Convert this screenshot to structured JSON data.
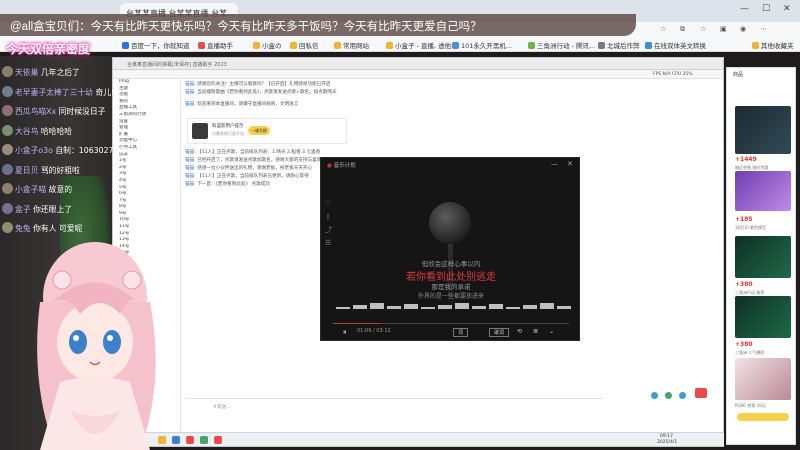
{
  "browser": {
    "tabs": [
      "台某某直播 台某某直播 台某...",
      "你好"
    ],
    "bookmarks": [
      "百度一下，你就知道",
      "直播助手",
      "小盒の",
      "回私信",
      "常用网站",
      "小盒子 - 直播, 透他...",
      "101永久开黑机...",
      "三角洲行动 - 腾讯...",
      "北城后作弊",
      "在线双体英文转换",
      "其他收藏夹"
    ],
    "window_controls": [
      "—",
      "☐",
      "✕"
    ]
  },
  "overlay": {
    "title": "@all盒宝贝们：今天有比昨天更快乐吗？今天有比昨天多干饭吗？今天有比昨天更爱自己吗？",
    "banner": "今天双倍亲密度"
  },
  "danmaku": [
    {
      "name": "天依巢",
      "text": "几年之后了",
      "color": "#8a7d6b"
    },
    {
      "name": "老早妻子太棒了三十幼",
      "text": "奇儿!",
      "color": "#6f7d8f"
    },
    {
      "name": "西瓜鸟喵Xx",
      "text": "同时候没日子",
      "color": "#8f6f6f"
    },
    {
      "name": "大谷鸟",
      "text": "哈哈哈哈",
      "color": "#7a8f6f"
    },
    {
      "name": "小盒子o3o",
      "text": "自制：1063027302",
      "color": "#9c8d7a"
    },
    {
      "name": "夏日贝",
      "text": "骂的好粗啦",
      "color": "#6f6f8f"
    },
    {
      "name": "小盒子喵",
      "text": "故意的",
      "color": "#8f7f6f"
    },
    {
      "name": "盒子",
      "text": "你还眼上了",
      "color": "#7a6f8f"
    },
    {
      "name": "兔兔",
      "text": "你有人 可爱呢",
      "color": "#8f8f6f"
    }
  ],
  "remote": {
    "titlebar": "台某某直播间的弹幕[未保存]  直播助手  2023",
    "toolbar_right": "FPS  N/A    CPU  35%",
    "sidebar_items": [
      "Prog",
      "主题",
      "功能",
      "我的",
      "直播工具",
      "三角洲的行动",
      "设置",
      "管理",
      "扩展",
      "功能中心",
      "在线工具",
      "投屏",
      "1号",
      "2号",
      "3号",
      "4号",
      "5号",
      "6号",
      "7号",
      "8号",
      "9号",
      "10号",
      "11号",
      "12号",
      "13号",
      "14号",
      "15号",
      "16号",
      "17号",
      "18号",
      "19号",
      "20号",
      "21号",
      "22号",
      "23号",
      "24号",
      "25号",
      "26号",
      "27号",
      "28号",
      "29号",
      "30号",
      "31号",
      "32号",
      "33号",
      "34号",
      "35号",
      "36号",
      "37号",
      "38号",
      "39号",
      "40号",
      "41号",
      "42号",
      "43号"
    ],
    "messages": [
      {
        "name": "猫猫:",
        "text": "感谢您的关注！主播可以唱歌吗？【已开启】礼物感谢功能已开启"
      },
      {
        "name": "猫猫:",
        "text": "当前播放歌曲《若你看到此处》，点歌请发送点歌+歌名，如点歌晴天"
      },
      {
        "name": "猫猫:",
        "text": "欢迎来到本直播间，请遵守直播间规则，文明发言"
      },
      {
        "name": "猫猫:",
        "text": "【11人】正在点歌，当前排队列表：1.晴天  2.稻香  3.七里香"
      },
      {
        "name": "猫猫:",
        "text": "已经开启了，点歌请发送点歌加歌名，感谢大家的支持与喜欢"
      },
      {
        "name": "猫猫:",
        "text": "感谢一位小伙伴送出的礼物，谢谢老板，祝老板天天开心"
      },
      {
        "name": "猫猫:",
        "text": "【11人】正在点歌，当前排队列表已更新，请耐心等待"
      },
      {
        "name": "猫猫:",
        "text": "下一首：《若你看到此处》 点歌成功"
      }
    ],
    "card": {
      "title": "科蓝影用户提示",
      "sub": "点歌系统已经开启",
      "badge": "一键兑换"
    },
    "input_placeholder": "#发送...",
    "taskbar_time": "09:17",
    "taskbar_date": "2025/4/1"
  },
  "player": {
    "title": "音乐计划",
    "lyrics": [
      "但欣会这样心事以内",
      "若你看到此处别逃走",
      "那是我的承诺",
      "外界的是一些都要放进来"
    ],
    "time": "01:09 / 03:12",
    "progress": 0.2,
    "buttons": [
      "词",
      "歌词"
    ]
  },
  "shop": {
    "header": "商品",
    "prices": [
      "+1449",
      "+185",
      "+380",
      "+380"
    ],
    "descs": [
      "暗区突围 限时特惠",
      "3D打印 紫色模型",
      "三角洲行动 推荐",
      "三角洲 人气爆款"
    ],
    "bottom": "PUBG 铁哥 49元"
  },
  "colors": {
    "overlay_bg": "#5c4846",
    "banner_glow": "#ff3fa8",
    "accent_red": "#e8342e"
  }
}
